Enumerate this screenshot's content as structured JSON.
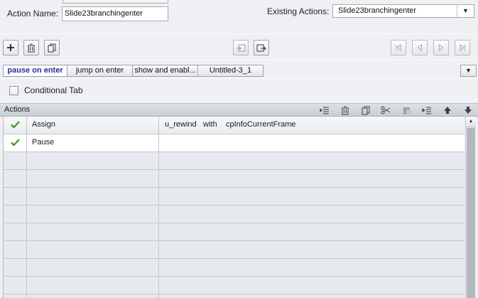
{
  "action_name": {
    "label": "Action Name:",
    "value": "Slide23branchingenter"
  },
  "existing_actions": {
    "label": "Existing Actions:",
    "value": "Slide23branchingenter"
  },
  "tabs": [
    {
      "label": "pause on enter",
      "active": true
    },
    {
      "label": "jump on enter",
      "active": false
    },
    {
      "label": "show and enabl...",
      "active": false
    },
    {
      "label": "Untitled-3_1",
      "active": false
    }
  ],
  "conditional_tab": {
    "label": "Conditional Tab",
    "checked": false
  },
  "actions_panel": {
    "title": "Actions",
    "rows": [
      {
        "enabled": true,
        "action": "Assign",
        "target": "u_rewind",
        "keyword": "with",
        "source": "cpInfoCurrentFrame"
      },
      {
        "enabled": true,
        "action": "Pause",
        "target": "",
        "keyword": "",
        "source": ""
      }
    ]
  },
  "colors": {
    "active_tab_text": "#1f2f9e",
    "check_green": "#3a9a24",
    "header_bar": "#cfd4db"
  }
}
